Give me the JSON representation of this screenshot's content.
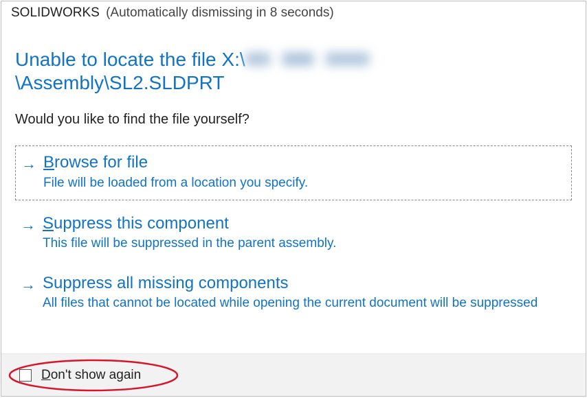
{
  "title": {
    "app": "SOLIDWORKS",
    "countdown": "(Automatically dismissing in 8 seconds)"
  },
  "headline": {
    "prefix": "Unable to locate the file X:\\",
    "suffix": "\\Assembly\\SL2.SLDPRT"
  },
  "question": "Would you like to find the file yourself?",
  "options": [
    {
      "title_pre": "",
      "title_u": "B",
      "title_post": "rowse for file",
      "desc": "File will be loaded from a location you specify."
    },
    {
      "title_pre": "",
      "title_u": "S",
      "title_post": "uppress this component",
      "desc": "This file will be suppressed in the parent assembly."
    },
    {
      "title_pre": "Suppress all missing components",
      "title_u": "",
      "title_post": "",
      "desc": "All files that cannot be located while opening the current document will be suppressed"
    }
  ],
  "footer": {
    "checkbox_pre": "",
    "checkbox_u": "D",
    "checkbox_post": "on't show again"
  }
}
